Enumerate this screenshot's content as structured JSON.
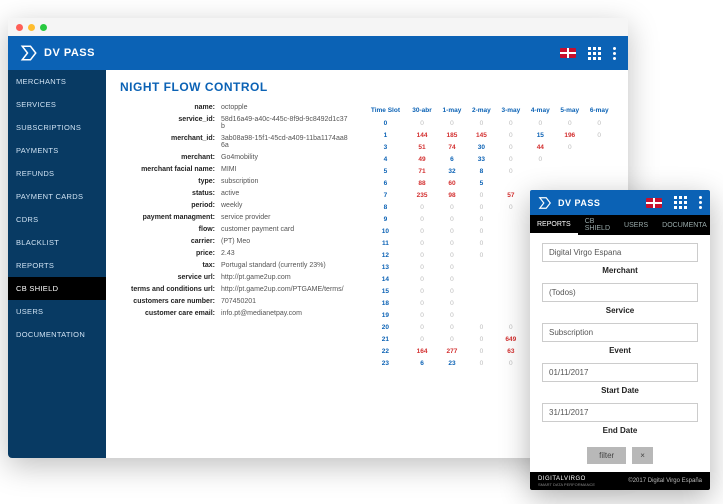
{
  "app": {
    "name": "DV PASS"
  },
  "sidebar": {
    "items": [
      "MERCHANTS",
      "SERVICES",
      "SUBSCRIPTIONS",
      "PAYMENTS",
      "REFUNDS",
      "PAYMENT CARDS",
      "CDRS",
      "BLACKLIST",
      "REPORTS",
      "CB SHIELD",
      "USERS",
      "DOCUMENTATION"
    ],
    "active_index": 9
  },
  "page": {
    "title": "NIGHT FLOW CONTROL"
  },
  "details": [
    {
      "label": "name:",
      "value": "octopple"
    },
    {
      "label": "service_id:",
      "value": "58d16a49-a40c-445c-8f9d-9c8492d1c37b"
    },
    {
      "label": "merchant_id:",
      "value": "3ab08a98-15f1-45cd-a409-11ba1174aa86a"
    },
    {
      "label": "merchant:",
      "value": "Go4mobility"
    },
    {
      "label": "merchant facial name:",
      "value": "MIMI"
    },
    {
      "label": "type:",
      "value": "subscription"
    },
    {
      "label": "status:",
      "value": "active"
    },
    {
      "label": "period:",
      "value": "weekly"
    },
    {
      "label": "payment managment:",
      "value": "service provider"
    },
    {
      "label": "flow:",
      "value": "customer payment card"
    },
    {
      "label": "carrier:",
      "value": "(PT) Meo"
    },
    {
      "label": "price:",
      "value": "2.43"
    },
    {
      "label": "tax:",
      "value": "Portugal standard (currently 23%)"
    },
    {
      "label": "service url:",
      "value": "http://pt.game2up.com"
    },
    {
      "label": "terms and conditions url:",
      "value": "http://pt.game2up.com/PTGAME/terms/"
    },
    {
      "label": "customers care number:",
      "value": "707450201"
    },
    {
      "label": "customer care email:",
      "value": "info.pt@medianetpay.com"
    }
  ],
  "table": {
    "headers": [
      "Time Slot",
      "30-abr",
      "1-may",
      "2-may",
      "3-may",
      "4-may",
      "5-may",
      "6-may"
    ],
    "rows": [
      [
        "0",
        "0",
        "0",
        "0",
        "0",
        "0",
        "0",
        "0"
      ],
      [
        "1",
        "144",
        "185",
        "145",
        "0",
        "15",
        "196",
        "0"
      ],
      [
        "3",
        "51",
        "74",
        "30",
        "0",
        "44",
        "0",
        ""
      ],
      [
        "4",
        "49",
        "6",
        "33",
        "0",
        "0",
        "",
        ""
      ],
      [
        "5",
        "71",
        "32",
        "8",
        "0",
        "",
        "",
        ""
      ],
      [
        "6",
        "88",
        "60",
        "5",
        "",
        "",
        "",
        ""
      ],
      [
        "7",
        "235",
        "98",
        "0",
        "57",
        "",
        "",
        ""
      ],
      [
        "8",
        "0",
        "0",
        "0",
        "0",
        "",
        "",
        ""
      ],
      [
        "9",
        "0",
        "0",
        "0",
        "",
        "",
        "",
        ""
      ],
      [
        "10",
        "0",
        "0",
        "0",
        "",
        "",
        "",
        ""
      ],
      [
        "11",
        "0",
        "0",
        "0",
        "",
        "",
        "",
        ""
      ],
      [
        "12",
        "0",
        "0",
        "0",
        "",
        "",
        "",
        ""
      ],
      [
        "13",
        "0",
        "0",
        "",
        "",
        "",
        "",
        ""
      ],
      [
        "14",
        "0",
        "0",
        "",
        "",
        "",
        "",
        ""
      ],
      [
        "15",
        "0",
        "0",
        "",
        "",
        "",
        "",
        ""
      ],
      [
        "18",
        "0",
        "0",
        "",
        "",
        "",
        "",
        ""
      ],
      [
        "19",
        "0",
        "0",
        "",
        "",
        "",
        "",
        ""
      ],
      [
        "20",
        "0",
        "0",
        "0",
        "0",
        "",
        "",
        ""
      ],
      [
        "21",
        "0",
        "0",
        "0",
        "649",
        "",
        "",
        ""
      ],
      [
        "22",
        "164",
        "277",
        "0",
        "63",
        "",
        "",
        ""
      ],
      [
        "23",
        "6",
        "23",
        "0",
        "0",
        "",
        "",
        ""
      ]
    ],
    "hot_threshold": 40
  },
  "mobile": {
    "app_name": "DV PASS",
    "tabs": [
      "REPORTS",
      "CB SHIELD",
      "USERS",
      "DOCUMENTA"
    ],
    "active_tab": 0,
    "fields": [
      {
        "value": "Digital Virgo Espana",
        "label": "Merchant"
      },
      {
        "value": "(Todos)",
        "label": "Service"
      },
      {
        "value": "Subscription",
        "label": "Event"
      },
      {
        "value": "01/11/2017",
        "label": "Start Date"
      },
      {
        "value": "31/11/2017",
        "label": "End Date"
      }
    ],
    "filter_btn": "filter",
    "clear_btn": "×",
    "footer_logo": "DIGITALVIRGO",
    "footer_tag": "SMART DATA PERFORMANCE",
    "footer_copy": "©2017 Digital Virgo España"
  }
}
